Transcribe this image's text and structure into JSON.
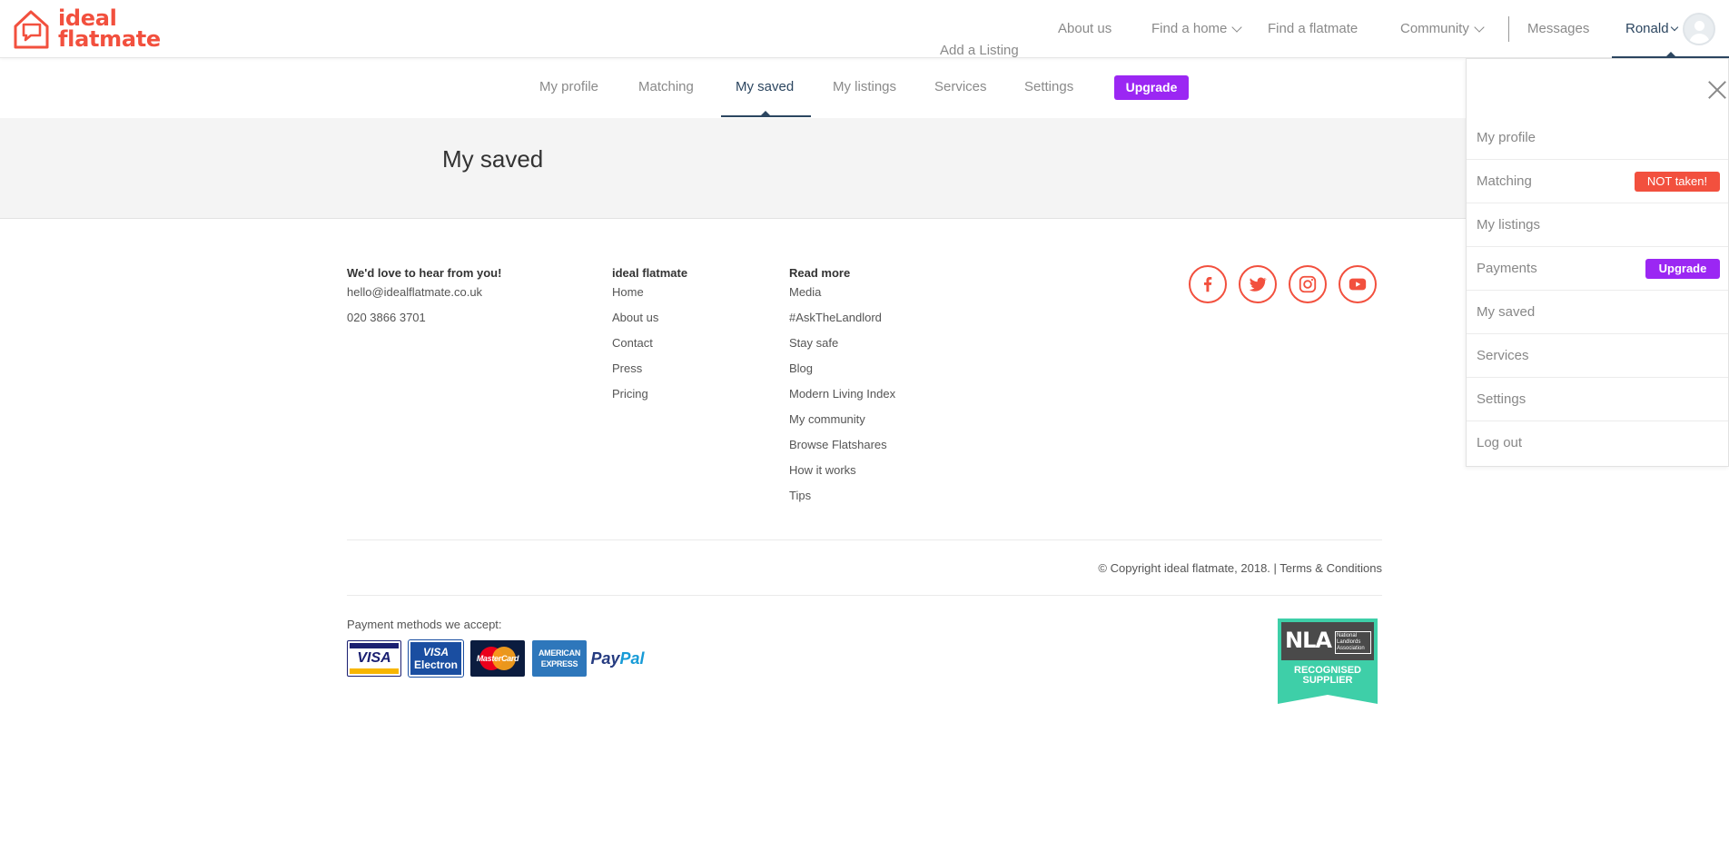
{
  "brand": {
    "line1": "ideal",
    "line2": "flatmate",
    "color": "#f2503e"
  },
  "topnav": {
    "add_listing": "Add a Listing",
    "about": "About us",
    "find_home": "Find a home",
    "find_flatmate": "Find a flatmate",
    "community": "Community",
    "messages": "Messages",
    "user": "Ronald"
  },
  "subnav": {
    "tabs": [
      "My profile",
      "Matching",
      "My saved",
      "My listings",
      "Services",
      "Settings"
    ],
    "active": "My saved",
    "upgrade": "Upgrade"
  },
  "page": {
    "title": "My saved"
  },
  "footer": {
    "contact": {
      "heading": "We'd love to hear from you!",
      "email": "hello@idealflatmate.co.uk",
      "phone": "020 3866 3701"
    },
    "company": {
      "heading": "ideal flatmate",
      "links": [
        "Home",
        "About us",
        "Contact",
        "Press",
        "Pricing"
      ]
    },
    "readmore": {
      "heading": "Read more",
      "links": [
        "Media",
        "#AskTheLandlord",
        "Stay safe",
        "Blog",
        "Modern Living Index",
        "My community",
        "Browse Flatshares",
        "How it works",
        "Tips"
      ]
    },
    "social": [
      "facebook-icon",
      "twitter-icon",
      "instagram-icon",
      "youtube-icon"
    ],
    "copyright": "© Copyright ideal flatmate, 2018. | Terms & Conditions",
    "payment_label": "Payment methods we accept:",
    "cards": {
      "visa": "VISA",
      "electron_top": "VISA",
      "electron_bottom": "Electron",
      "mastercard": "MasterCard",
      "amex_top": "AMERICAN",
      "amex_bottom": "EXPRESS",
      "paypal_a": "Pay",
      "paypal_b": "Pal"
    },
    "nla": {
      "abbr": "NLA",
      "full": "National Landlords Association",
      "line1": "RECOGNISED",
      "line2": "SUPPLIER"
    }
  },
  "dropdown": {
    "items": [
      "My profile",
      "Matching",
      "My listings",
      "Payments",
      "My saved",
      "Services",
      "Settings",
      "Log out"
    ],
    "matching_badge": "NOT taken!",
    "payments_badge": "Upgrade"
  },
  "colors": {
    "accent": "#f2503e",
    "navy": "#2c4660",
    "upgrade": "#9b27f3",
    "nla": "#3ecfa8"
  }
}
